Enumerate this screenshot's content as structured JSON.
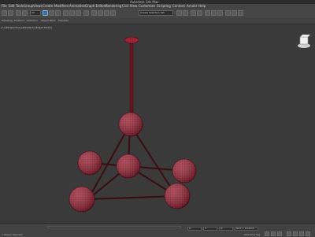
{
  "window": {
    "title": "Autodesk 3ds Max"
  },
  "menubar": {
    "items": [
      "File",
      "Edit",
      "Tools",
      "Group",
      "Views",
      "Create",
      "Modifiers",
      "Animation",
      "Graph Editors",
      "Rendering",
      "Civil View",
      "Customize",
      "Scripting",
      "Content",
      "Arnold",
      "Help"
    ],
    "search_placeholder": "Sign In"
  },
  "toolbar": {
    "selection_filter": "All",
    "named_selection": "Create Selection Set"
  },
  "ribbon": {
    "tabs": [
      "Modeling",
      "Freeform",
      "Selection",
      "Object Paint",
      "Populate"
    ]
  },
  "viewport": {
    "label": "[+] [Perspective] [Standard] [Edged Faces]"
  },
  "model": {
    "accent_color": "#a3283a"
  },
  "statusbar": {
    "left_text": "1 Object Selected",
    "right_text": "Add Time Tag",
    "x_value": "X:",
    "y_value": "Y:",
    "z_value": "Z:",
    "grid_value": "Grid = 10.0mm"
  }
}
